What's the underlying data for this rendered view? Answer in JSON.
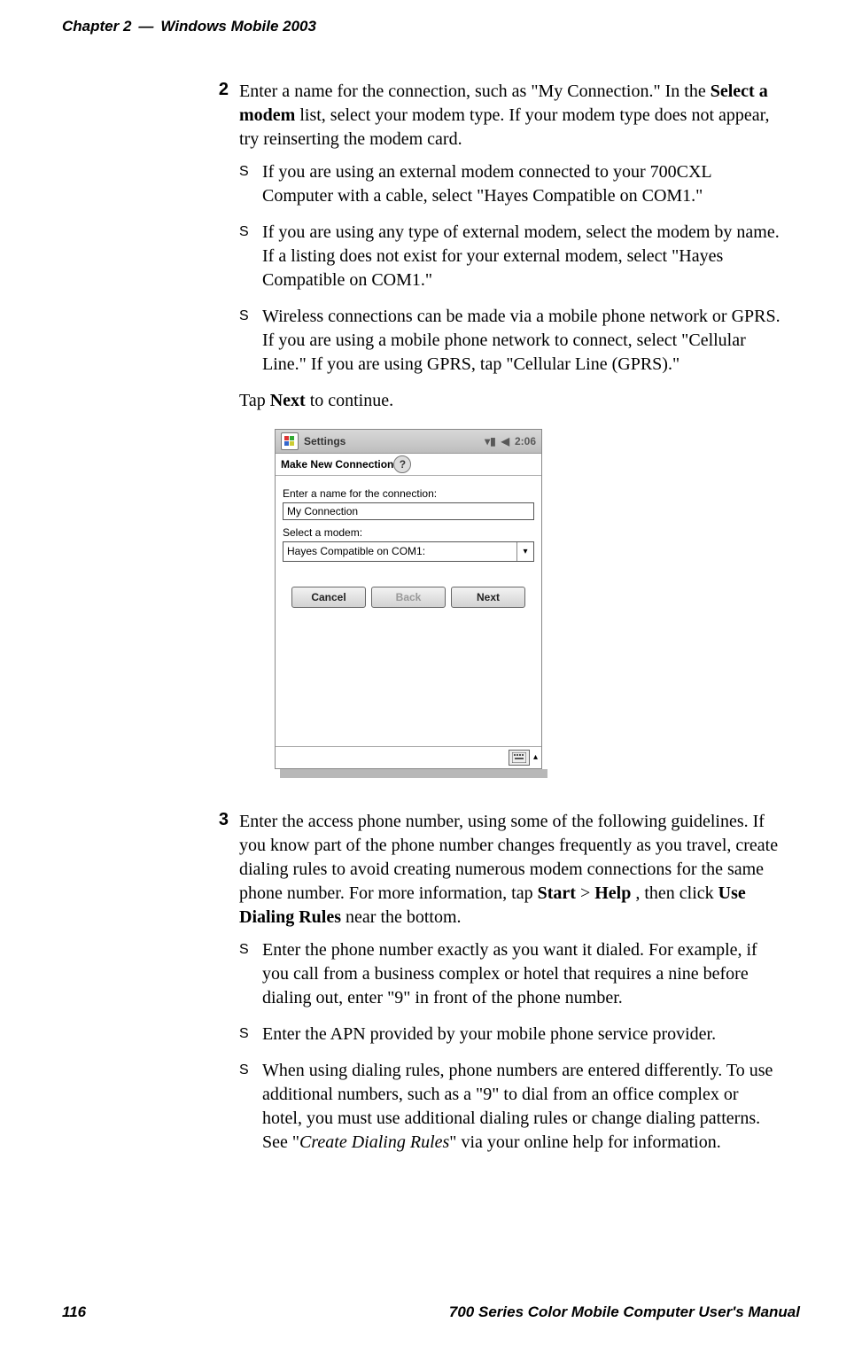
{
  "header": {
    "chapter": "Chapter 2",
    "separator": "—",
    "title": "Windows Mobile 2003"
  },
  "steps": {
    "s2": {
      "num": "2",
      "p1a": "Enter a name for the connection, such as \"My Connection.\" In the ",
      "p1b": "Select a modem",
      "p1c": " list, select your modem type. If your modem type does not appear, try reinserting the modem card.",
      "b1": "If you are using an external modem connected to your 700CXL Computer with a cable, select \"Hayes Compatible on COM1.\"",
      "b2": "If you are using any type of external modem, select the modem by name. If a listing does not exist for your external modem, select \"Hayes Compatible on COM1.\"",
      "b3": "Wireless connections can be made via a mobile phone network or GPRS. If you are using a mobile phone network to connect, select \"Cellular Line.\" If you are using GPRS, tap \"Cellular Line (GPRS).\"",
      "p2a": "Tap ",
      "p2b": "Next",
      "p2c": " to continue."
    },
    "s3": {
      "num": "3",
      "p1a": "Enter the access phone number, using some of the following guidelines. If you know part of the phone number changes frequently as you travel, create dialing rules to avoid creating numerous modem connections for the same phone number. For more information, tap ",
      "p1b": "Start",
      "p1c": " > ",
      "p1d": "Help",
      "p1e": " , then click ",
      "p1f": "Use Dialing Rules",
      "p1g": " near the bottom.",
      "b1": "Enter the phone number exactly as you want it dialed. For example, if you call from a business complex or hotel that requires a nine before dialing out, enter \"9\" in front of the phone number.",
      "b2": "Enter the APN provided by your mobile phone service provider.",
      "b3a": "When using dialing rules, phone numbers are entered differently. To use additional numbers, such as a \"9\" to dial from an office complex or hotel, you must use additional dialing rules or change dialing patterns. See \"",
      "b3b": "Create Dialing Rules",
      "b3c": "\" via your online help for information."
    }
  },
  "mock": {
    "titlebar": "Settings",
    "signal": "▾▮",
    "speaker": "◀",
    "clock": "2:06",
    "subtitle": "Make New Connection",
    "help": "?",
    "label_name": "Enter a name for the connection:",
    "input_name": "My Connection",
    "label_modem": "Select a modem:",
    "select_modem": "Hayes Compatible on COM1:",
    "btn_cancel": "Cancel",
    "btn_back": "Back",
    "btn_next": "Next",
    "up": "▴"
  },
  "footer": {
    "page": "116",
    "title": "700 Series Color Mobile Computer User's Manual"
  }
}
